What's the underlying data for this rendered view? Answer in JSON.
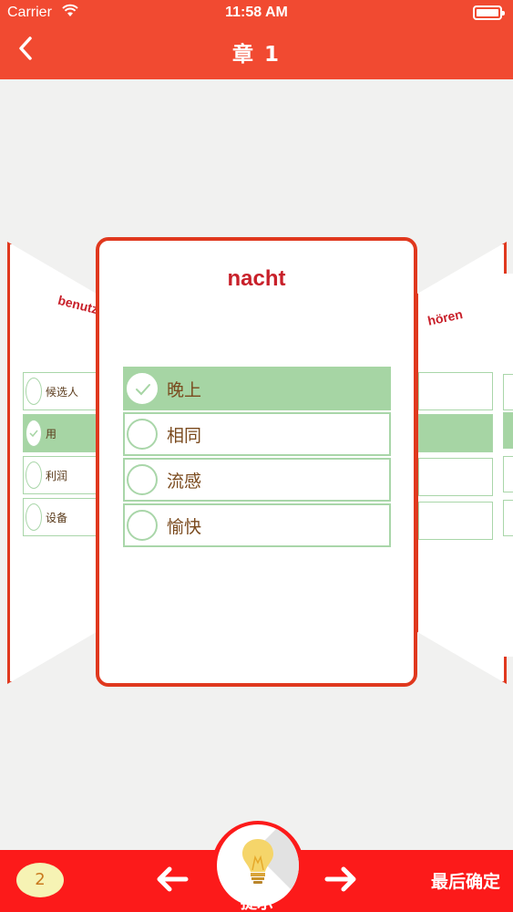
{
  "status_bar": {
    "carrier": "Carrier",
    "time": "11:58 AM"
  },
  "header": {
    "title": "章 1",
    "back_icon": "chevron-left-icon"
  },
  "cards": {
    "current": {
      "word": "nacht",
      "options": [
        {
          "label": "晚上",
          "selected": true
        },
        {
          "label": "相同",
          "selected": false
        },
        {
          "label": "流感",
          "selected": false
        },
        {
          "label": "愉快",
          "selected": false
        }
      ]
    },
    "previous": {
      "word": "benutzen",
      "options": [
        {
          "label": "候选人",
          "selected": false
        },
        {
          "label": "用",
          "selected": true
        },
        {
          "label": "利润",
          "selected": false
        },
        {
          "label": "设备",
          "selected": false
        }
      ]
    },
    "next": {
      "word": "hören"
    }
  },
  "bottom_bar": {
    "count": "2",
    "hint_label": "提示",
    "confirm_label": "最后确定",
    "prev_icon": "arrow-left-icon",
    "next_icon": "arrow-right-icon",
    "hint_icon": "lightbulb-icon"
  },
  "colors": {
    "header": "#f14a31",
    "bottom_bar": "#fc1a1a",
    "card_border": "#e0381e",
    "selected_option": "#a6d5a4",
    "word": "#c8202a"
  }
}
